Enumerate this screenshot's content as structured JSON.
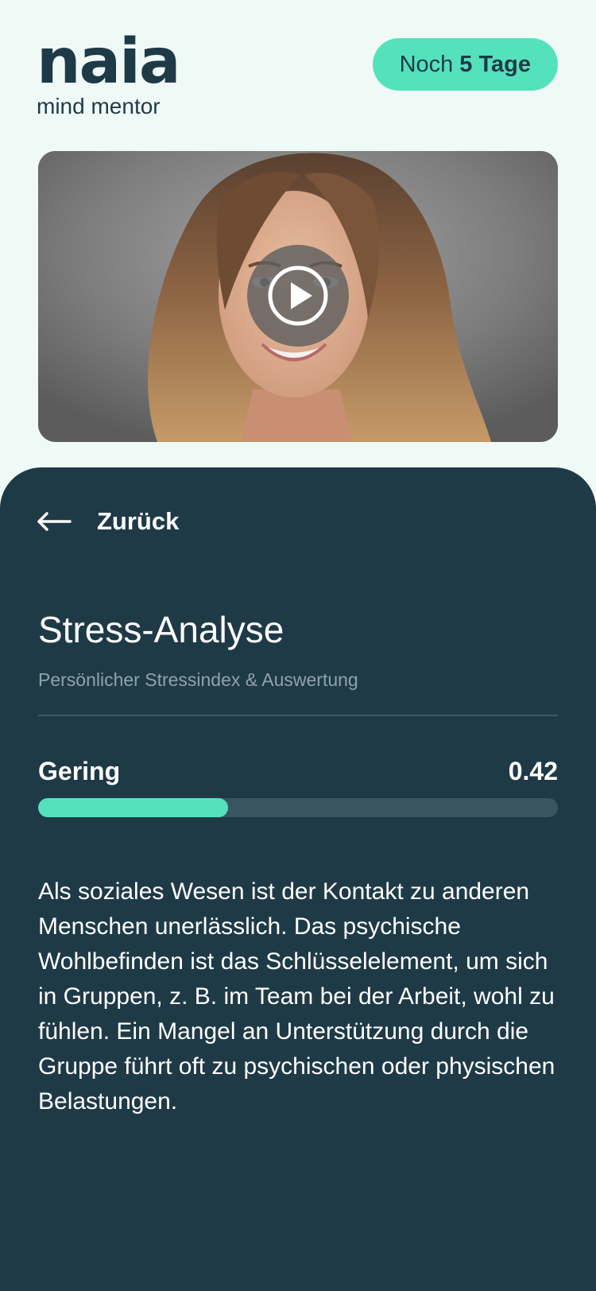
{
  "header": {
    "logo_word": "naia",
    "logo_sub": "mind mentor",
    "days_prefix": "Noch",
    "days_value": "5 Tage"
  },
  "video": {
    "play_icon": "play-icon"
  },
  "panel": {
    "back_label": "Zurück",
    "back_icon": "arrow-left-icon",
    "title": "Stress-Analyse",
    "subtitle": "Persönlicher Stressindex & Auswertung",
    "level_label": "Gering",
    "score": "0.42",
    "progress": 0.365,
    "description": "Als soziales Wesen ist der Kontakt zu anderen Menschen unerlässlich. Das psychische Wohlbefinden ist das Schlüsselelement, um sich in Gruppen, z. B. im Team bei der Arbeit, wohl zu fühlen. Ein Mangel an Unterstützung durch die Gruppe führt oft zu psychischen oder physischen Belastungen."
  },
  "colors": {
    "accent": "#54e2bd",
    "panel_bg": "#1f3a47",
    "page_bg": "#effaf6",
    "brand_text": "#1e3a47"
  }
}
